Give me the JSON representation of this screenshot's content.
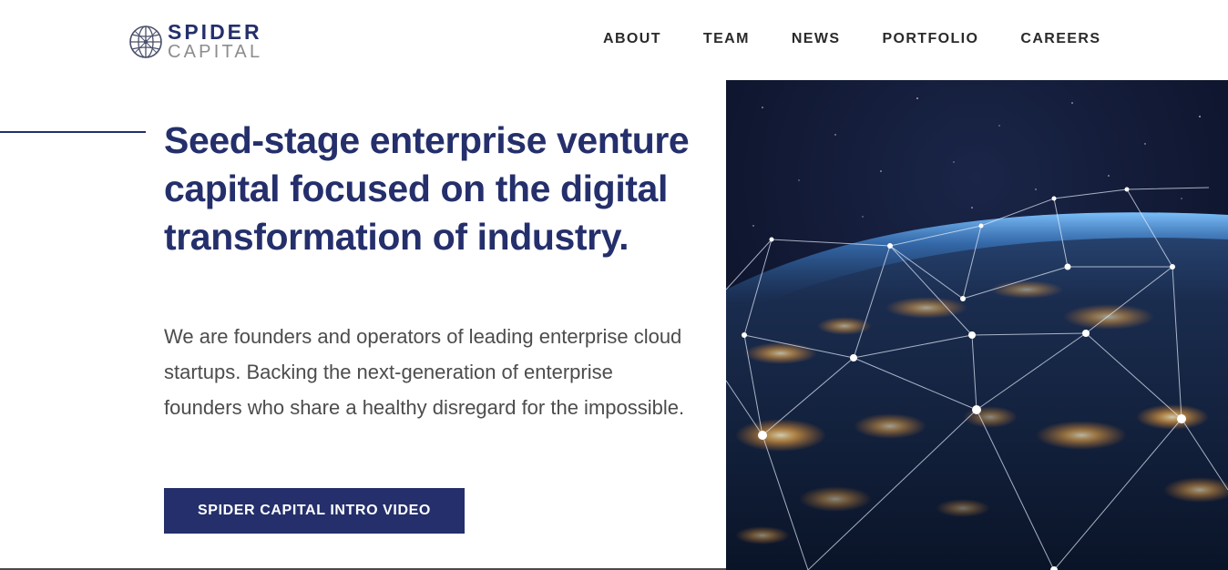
{
  "brand": {
    "name_line1": "SPIDER",
    "name_line2": "CAPITAL",
    "primary_color": "#242f6b",
    "secondary_color": "#8c8c8c"
  },
  "nav": {
    "items": [
      {
        "label": "ABOUT"
      },
      {
        "label": "TEAM"
      },
      {
        "label": "NEWS"
      },
      {
        "label": "PORTFOLIO"
      },
      {
        "label": "CAREERS"
      }
    ]
  },
  "hero": {
    "headline": "Seed-stage enterprise venture capital focused on the digital transformation of industry.",
    "subtext": "We are founders and operators of leading enterprise cloud startups.  Backing the next-generation of enterprise founders who share a healthy disregard for the impossible.",
    "cta_label": "SPIDER CAPITAL INTRO VIDEO",
    "image_icon": "earth-network-at-night-image"
  }
}
